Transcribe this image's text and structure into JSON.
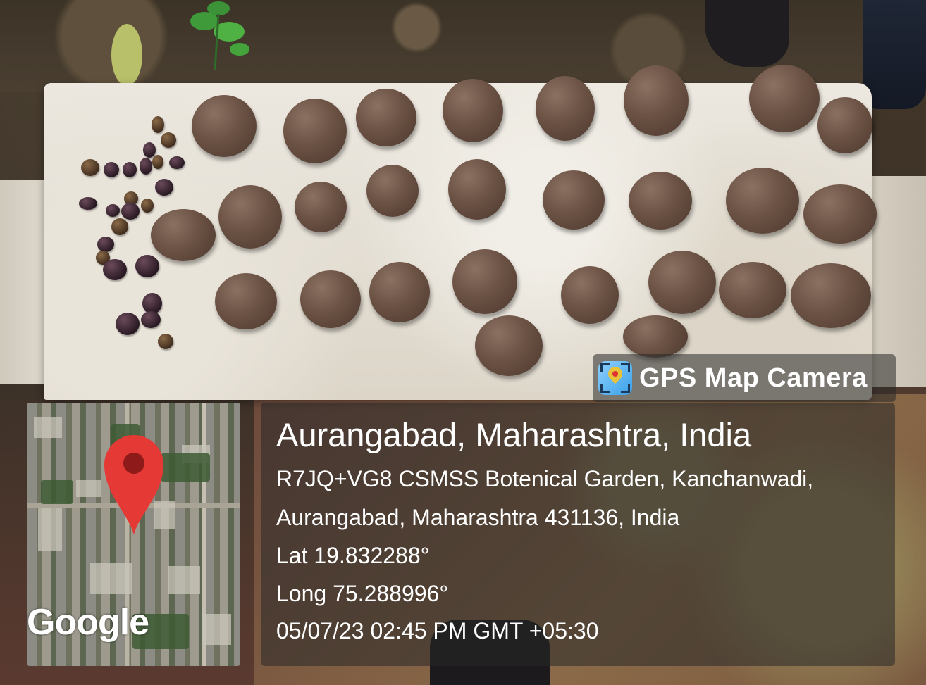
{
  "overlay": {
    "brand": {
      "label": "GPS Map Camera",
      "icon": "gps-map-camera-logo-icon"
    },
    "map": {
      "watermark": "Google",
      "marker_icon": "map-pin-icon"
    },
    "location": {
      "title": "Aurangabad, Maharashtra, India",
      "address_line1": "R7JQ+VG8 CSMSS Botenical Garden, Kanchanwadi,",
      "address_line2": "Aurangabad, Maharashtra 431136, India",
      "latitude": "Lat 19.832288°",
      "longitude": "Long 75.288996°",
      "timestamp": "05/07/23 02:45 PM GMT +05:30"
    }
  },
  "colors": {
    "panel_bg": "#282828",
    "marker_red": "#e53935",
    "text": "#ffffff"
  }
}
